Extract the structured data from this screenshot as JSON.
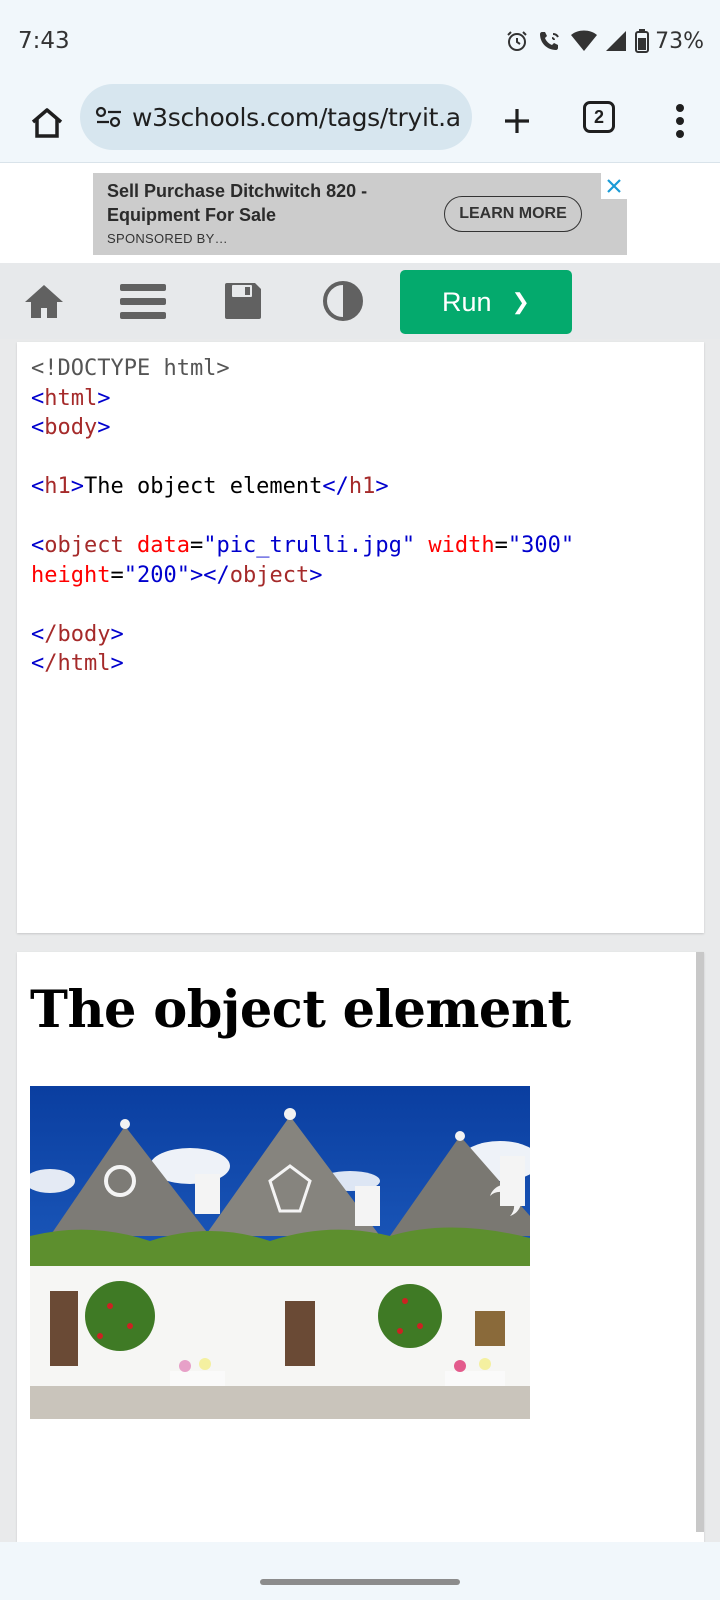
{
  "status_bar": {
    "time": "7:43",
    "battery": "73%",
    "icons": [
      "alarm-icon",
      "wifi-calling-icon",
      "wifi-icon",
      "cell-signal-icon",
      "battery-icon"
    ]
  },
  "browser": {
    "url": "w3schools.com/tags/tryit.a",
    "tab_count": "2"
  },
  "ad": {
    "title": "Sell Purchase Ditchwitch 820 - Equipment For Sale",
    "sponsored": "SPONSORED BY…",
    "cta": "LEARN MORE"
  },
  "toolbar": {
    "run_label": "Run",
    "run_chevron": "❯",
    "accent": "#04aa6d"
  },
  "code": {
    "doctype": "<!DOCTYPE html>",
    "html_open": "html",
    "body_open": "body",
    "h1_tag": "h1",
    "h1_text": "The object element",
    "object_tag": "object",
    "attr_data": "data",
    "val_data": "\"pic_trulli.jpg\"",
    "attr_width": "width",
    "val_width": "\"300\"",
    "attr_height": "height",
    "val_height": "\"200\"",
    "body_close": "/body",
    "html_close": "/html"
  },
  "result": {
    "heading": "The object element"
  }
}
